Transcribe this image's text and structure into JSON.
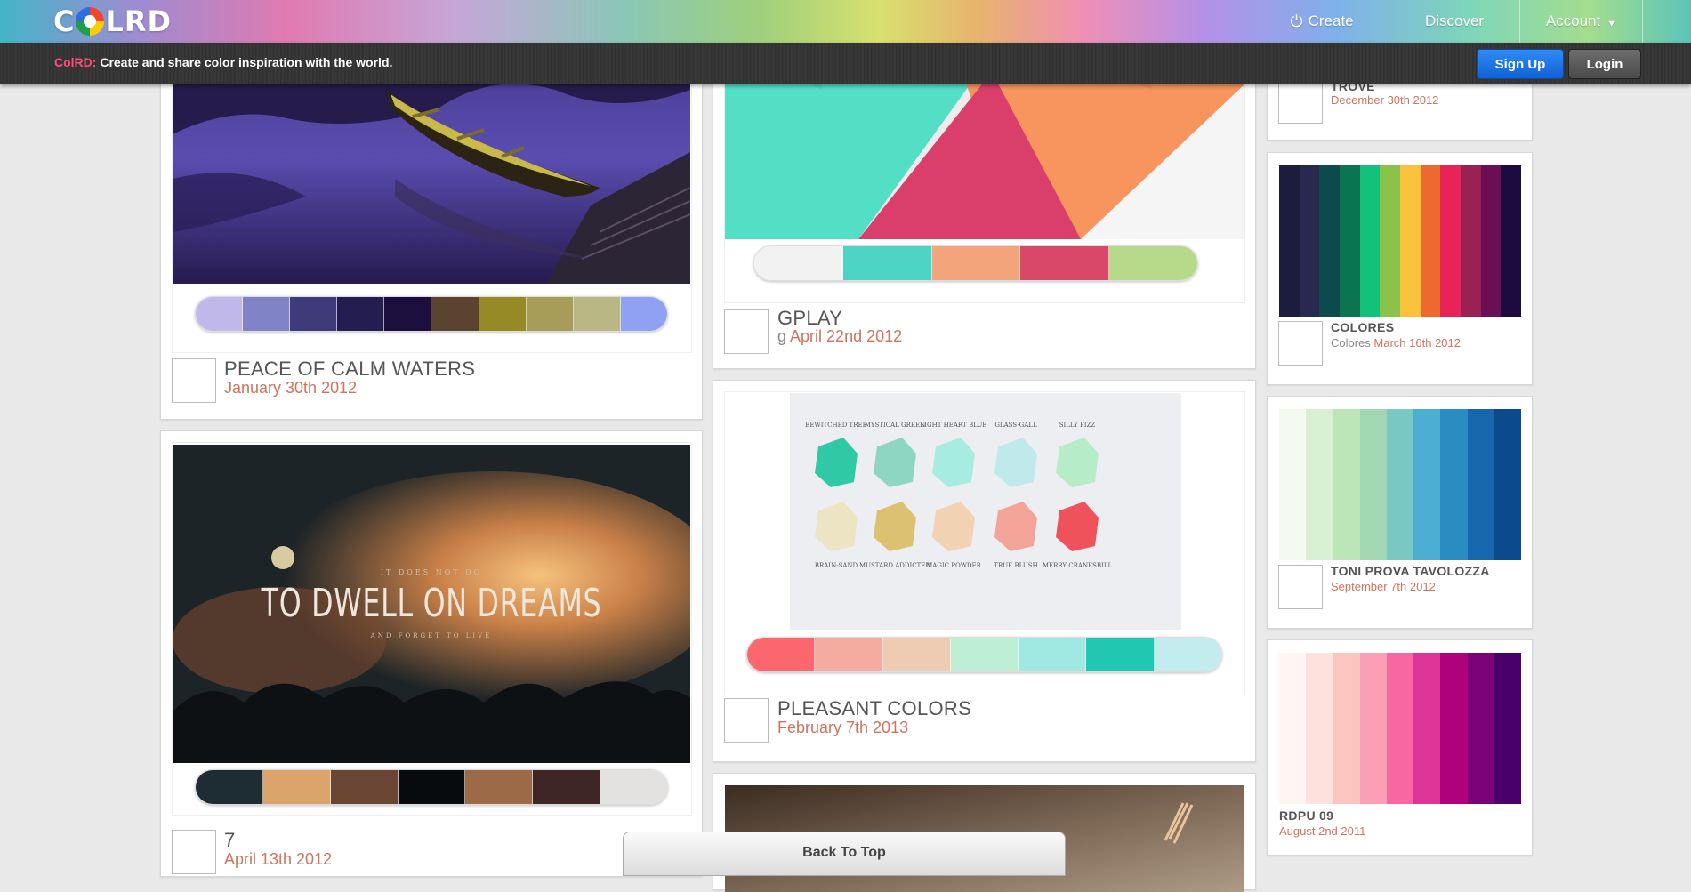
{
  "header": {
    "logo_left": "C",
    "logo_right": "LRD",
    "nav": {
      "create": "Create",
      "discover": "Discover",
      "account": "Account"
    }
  },
  "subbar": {
    "brand": "ColRD:",
    "tagline": "Create and share color inspiration with the world.",
    "signup": "Sign Up",
    "login": "Login"
  },
  "col1": [
    {
      "title": "PEACE OF CALM WATERS",
      "date": "January 30th 2012",
      "palette": [
        "#c0b8e8",
        "#8084c6",
        "#3f3a7a",
        "#231d50",
        "#1d0f3d",
        "#5a4430",
        "#958a25",
        "#a89c59",
        "#b9b784",
        "#90a0f3"
      ]
    },
    {
      "title": "7",
      "date": "April 13th 2012",
      "overlay_small": "IT DOES NOT DO",
      "overlay_big": "TO DWELL ON DREAMS",
      "overlay_sub": "AND FORGET TO LIVE",
      "palette": [
        "#1e2d33",
        "#dba46b",
        "#6a4533",
        "#080b0e",
        "#9c6a47",
        "#3e2627",
        "#e4e1e1"
      ]
    }
  ],
  "col2": [
    {
      "title": "GPLAY",
      "by": "g",
      "date": "April 22nd 2012",
      "palette": [
        "#f2f2f2",
        "#4cd4c4",
        "#f4a47a",
        "#d94868",
        "#b6da8a"
      ]
    },
    {
      "title": "PLEASANT COLORS",
      "date": "February 7th 2013",
      "stones_top": [
        "BEWITCHED TREE",
        "MYSTICAL GREEN",
        "LIGHT HEART BLUE",
        "GLASS-GALL",
        "SILLY FIZZ"
      ],
      "stones_bottom": [
        "BRAIN-SAND",
        "MUSTARD ADDICTED",
        "MAGIC POWDER",
        "TRUE BLUSH",
        "MERRY CRANESBILL"
      ],
      "palette": [
        "#fc666e",
        "#f4aba0",
        "#eeccb3",
        "#bdefd5",
        "#9fe9e2",
        "#21c7b0",
        "#c3ecee"
      ]
    }
  ],
  "col3": [
    {
      "title": "TROVE",
      "date": "December 30th 2012"
    },
    {
      "title": "COLORES",
      "by": "Colores",
      "date": "March 16th 2012",
      "stripes": [
        "#1c1c3d",
        "#272a4e",
        "#0c4a4e",
        "#0a7550",
        "#13c27a",
        "#8bc34a",
        "#fac13a",
        "#ee6930",
        "#e8235a",
        "#9b2154",
        "#6a0f55",
        "#1b0b3e"
      ]
    },
    {
      "title": "TONI PROVA TAVOLOZZA",
      "date": "September 7th 2012",
      "stripes": [
        "#f5faee",
        "#d9f1d3",
        "#bde6b8",
        "#a2d7b3",
        "#79c8c4",
        "#4baed2",
        "#2b8cc1",
        "#1667ab",
        "#0a4a8d"
      ]
    },
    {
      "title": "RDPU 09",
      "date": "August 2nd 2011",
      "stripes": [
        "#fff6f3",
        "#fde1dd",
        "#fcc5c0",
        "#fa9fb5",
        "#f768a1",
        "#dd3497",
        "#ae017e",
        "#7a0177",
        "#49006a"
      ]
    }
  ],
  "back_to_top": "Back To Top"
}
